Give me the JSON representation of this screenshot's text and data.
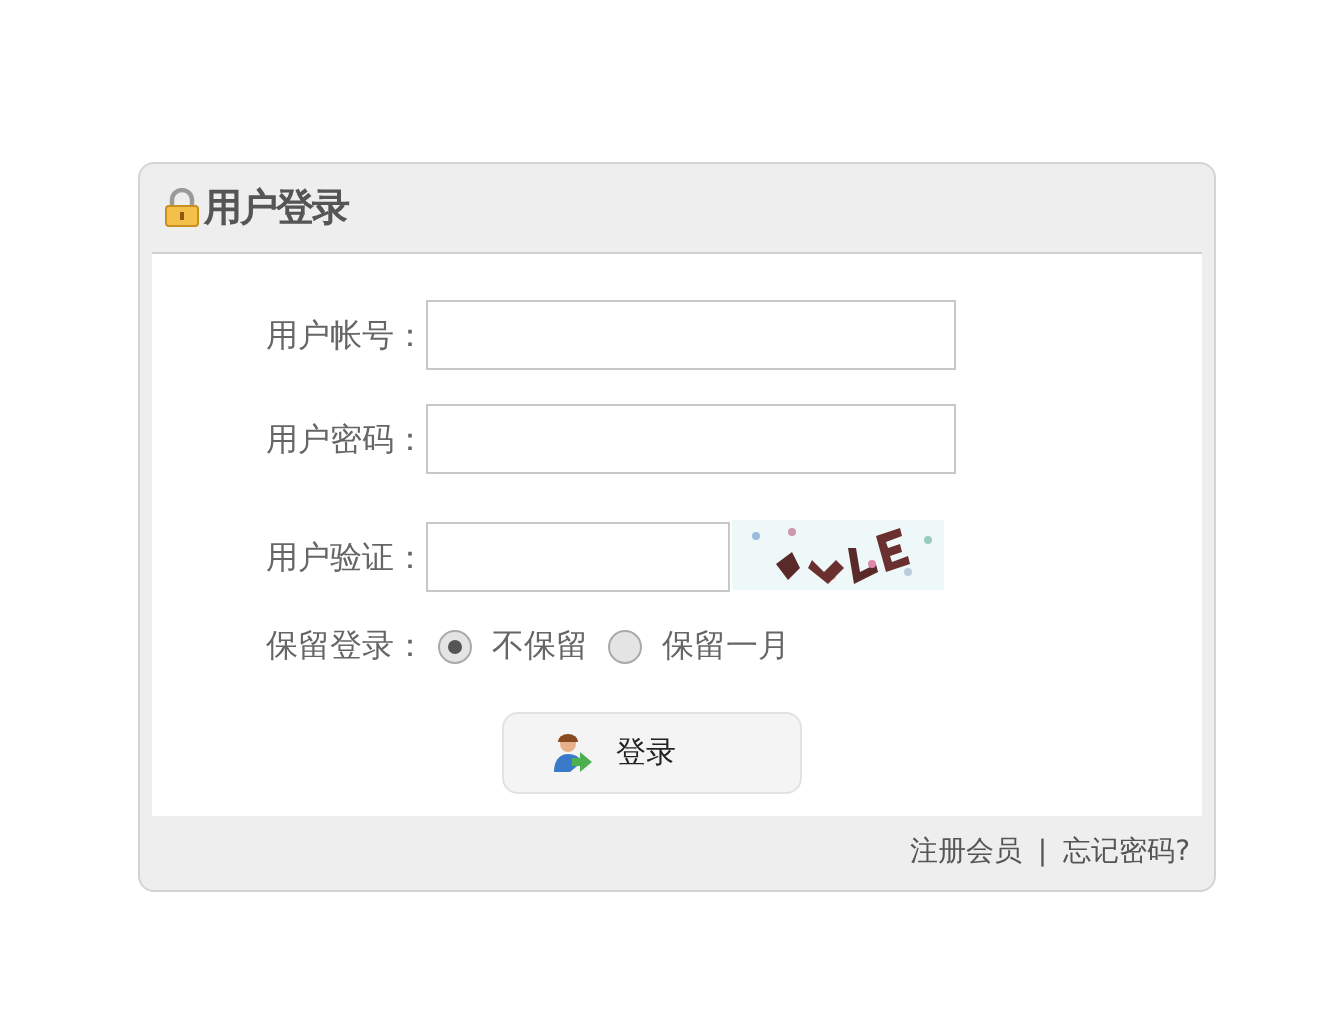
{
  "panel": {
    "title": "用户登录"
  },
  "fields": [
    {
      "label": "用户帐号：",
      "kind": "text"
    },
    {
      "label": "用户密码：",
      "kind": "text"
    },
    {
      "label": "用户验证：",
      "kind": "captcha"
    }
  ],
  "remember": {
    "label": "保留登录：",
    "options": [
      {
        "label": "不保留",
        "selected": true
      },
      {
        "label": "保留一月",
        "selected": false
      }
    ]
  },
  "submit": {
    "label": "登录"
  },
  "footer": {
    "links": [
      "注册会员",
      "忘记密码?"
    ],
    "separator": "|"
  }
}
